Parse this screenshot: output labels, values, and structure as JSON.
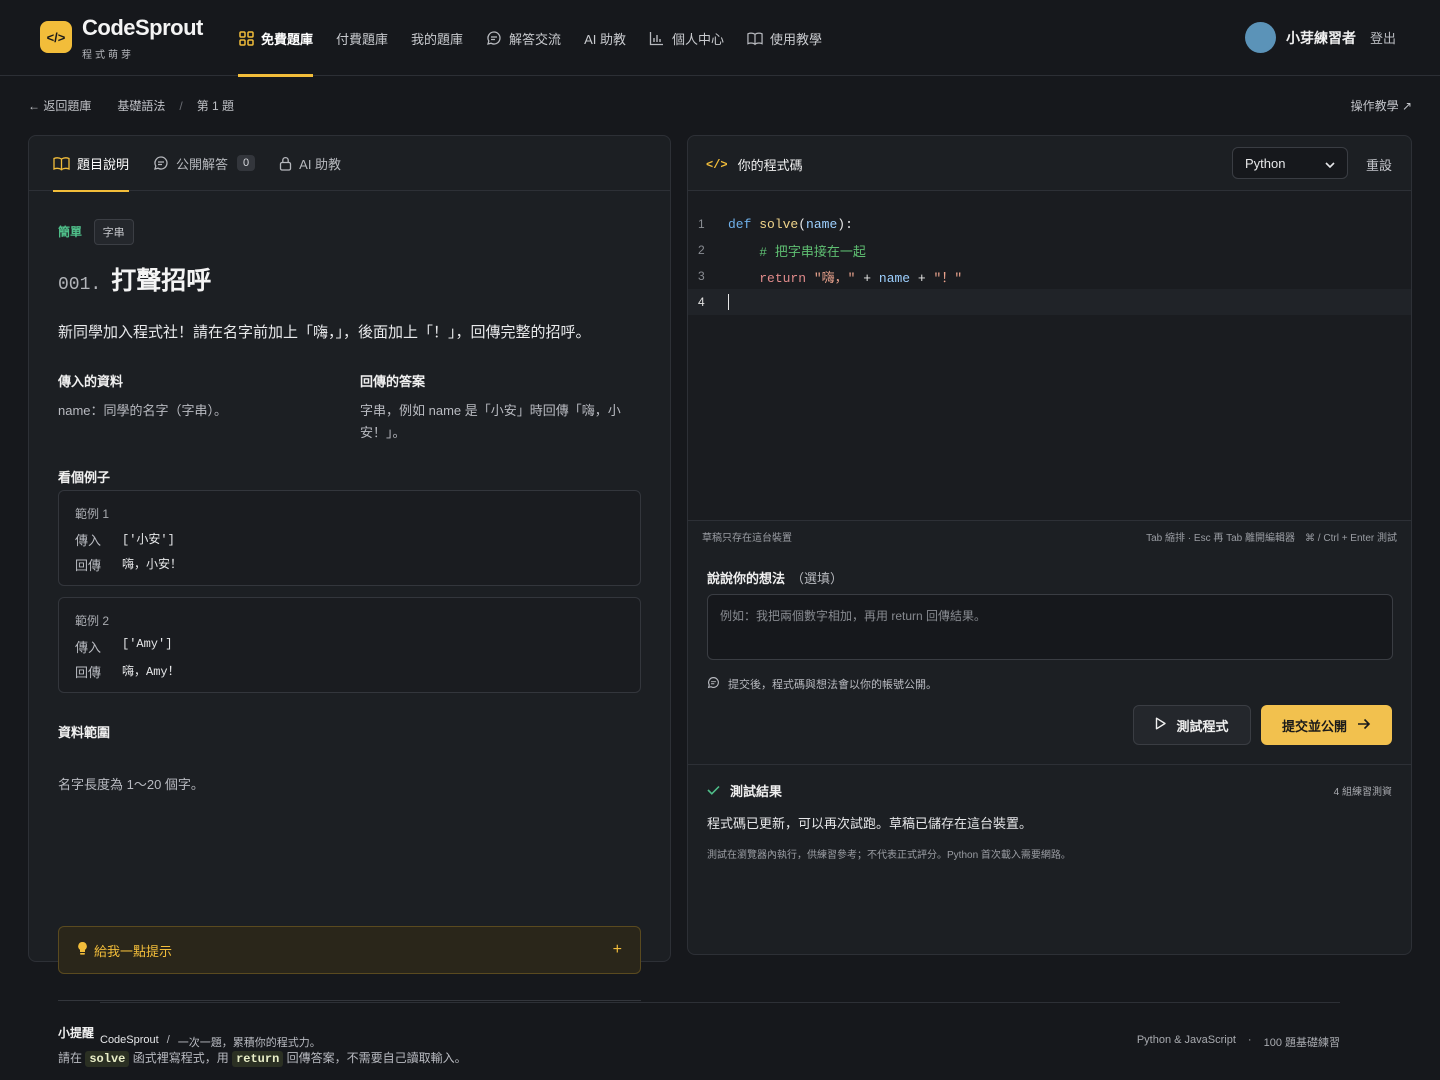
{
  "brand": {
    "name": "CodeSprout",
    "subtitle": "程式萌芽",
    "logo_glyph": "</>",
    "accent": "#f2bd3a"
  },
  "nav": [
    {
      "label": "免費題庫",
      "icon": "grid-icon",
      "active": true
    },
    {
      "label": "付費題庫",
      "icon": "",
      "active": false
    },
    {
      "label": "我的題庫",
      "icon": "",
      "active": false
    },
    {
      "label": "解答交流",
      "icon": "chat-icon",
      "active": false
    },
    {
      "label": "AI 助教",
      "icon": "",
      "active": false
    },
    {
      "label": "個人中心",
      "icon": "bar-chart-icon",
      "active": false
    },
    {
      "label": "使用教學",
      "icon": "book-icon",
      "active": false
    }
  ],
  "user": {
    "name": "小芽練習者",
    "logout": "登出"
  },
  "breadcrumb": {
    "back": "← 返回題庫",
    "category": "基礎語法",
    "separator": "/",
    "current": "第 1 題"
  },
  "guide": "操作教學 ↗",
  "left_tabs": [
    {
      "label": "題目說明",
      "icon": "book-icon"
    },
    {
      "label": "公開解答",
      "icon": "chat-icon",
      "count": "0"
    },
    {
      "label": "AI 助教",
      "icon": "lock-icon"
    }
  ],
  "problem": {
    "difficulty": "簡單",
    "tag": "字串",
    "number": "001.",
    "title": "打聲招呼",
    "description": "新同學加入程式社！請在名字前加上「嗨，」，後面加上「！」，回傳完整的招呼。",
    "input_heading": "傳入的資料",
    "input_text": "name：同學的名字（字串）。",
    "output_heading": "回傳的答案",
    "output_text": "字串，例如 name 是「小安」時回傳「嗨，小安！」。",
    "examples_heading": "看個例子",
    "examples": [
      {
        "title": "範例 1",
        "in_label": "傳入",
        "in": "['小安']",
        "out_label": "回傳",
        "out": "嗨，小安！"
      },
      {
        "title": "範例 2",
        "in_label": "傳入",
        "in": "['Amy']",
        "out_label": "回傳",
        "out": "嗨，Amy！"
      }
    ],
    "range_heading": "資料範圍",
    "range_text": "名字長度為 1～20 個字。",
    "hint_label": "給我一點提示",
    "hint_toggle": "+",
    "tip_heading": "小提醒",
    "tip_pre": "請在",
    "tip_code1": "solve",
    "tip_mid": "函式裡寫程式，用",
    "tip_code2": "return",
    "tip_post": "回傳答案，不需要自己讀取輸入。"
  },
  "editor": {
    "title": "你的程式碼",
    "title_icon": "</>",
    "language": "Python",
    "reset": "重設",
    "lines": [
      "1",
      "2",
      "3",
      "4"
    ],
    "code": {
      "l1_kw": "def",
      "l1_fn": "solve",
      "l1_open": "(",
      "l1_arg": "name",
      "l1_close": "):",
      "l2_comment": "# 把字串接在一起",
      "l3_kw": "return",
      "l3_s1": "\"嗨，\"",
      "l3_op1": "+",
      "l3_var": "name",
      "l3_op2": "+",
      "l3_s2": "\"！\""
    },
    "status_left": "草稿只存在這台裝置",
    "status_right": "Tab 縮排 · Esc 再 Tab 離開編輯器　⌘ / Ctrl + Enter 測試"
  },
  "thoughts": {
    "heading": "說說你的想法",
    "optional": "（選填）",
    "placeholder": "例如：我把兩個數字相加，再用 return 回傳結果。",
    "note": "提交後，程式碼與想法會以你的帳號公開。"
  },
  "actions": {
    "test": "測試程式",
    "submit": "提交並公開"
  },
  "result": {
    "heading": "測試結果",
    "count": "4 組練習測資",
    "message": "程式碼已更新，可以再次試跑。草稿已儲存在這台裝置。",
    "sub": "測試在瀏覽器內執行，供練習參考；不代表正式評分。Python 首次載入需要網路。"
  },
  "footer": {
    "brand": "CodeSprout",
    "sep": "/",
    "tagline": "一次一題，累積你的程式力。",
    "langs": "Python & JavaScript",
    "dot": "·",
    "count": "100 題基礎練習"
  }
}
